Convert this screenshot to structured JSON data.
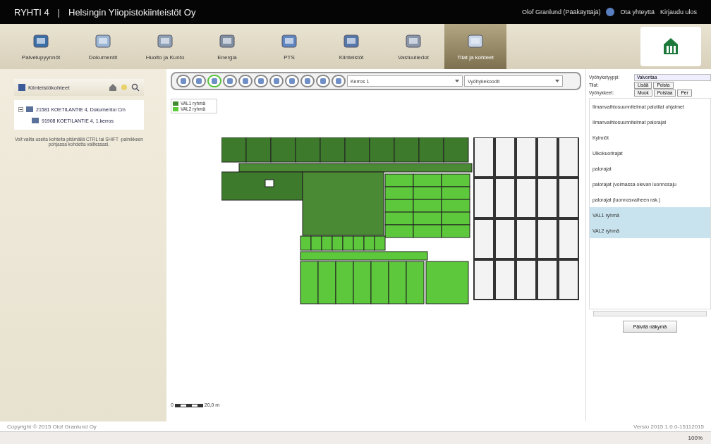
{
  "header": {
    "app": "RYHTI 4",
    "separator": "|",
    "company": "Helsingin Yliopistokiinteistöt Oy",
    "user": "Olof Granlund (Pääkäyttäjä)",
    "links": [
      "Ota yhteyttä",
      "Kirjaudu ulos"
    ]
  },
  "nav": [
    {
      "label": "Palvelupyynnöt",
      "selected": false
    },
    {
      "label": "Dokumentit",
      "selected": false
    },
    {
      "label": "Huolto ja Kunto",
      "selected": false
    },
    {
      "label": "Energia",
      "selected": false
    },
    {
      "label": "PTS",
      "selected": false
    },
    {
      "label": "Kiinteistöt",
      "selected": false
    },
    {
      "label": "Vastuutiedot",
      "selected": false
    },
    {
      "label": "Tilat ja kohteet",
      "selected": true
    }
  ],
  "sidebar": {
    "title": "Kiinteistökohteet",
    "tree": [
      {
        "label": "21581 KOETILANTIE 4, Dokumentoi Cm",
        "expanded": true,
        "children": [
          {
            "label": "91908 KOETILANTIE 4, 1.kerros"
          }
        ]
      }
    ],
    "note": "Voit valita useita kohteita pitämällä CTRL tai SHIFT -painikkeen pohjassa kohdetta valitessasi."
  },
  "toolbar": {
    "tools": [
      {
        "selected": false
      },
      {
        "selected": false
      },
      {
        "selected": true
      },
      {
        "selected": false
      },
      {
        "selected": false
      },
      {
        "selected": false
      },
      {
        "selected": false
      },
      {
        "selected": false
      },
      {
        "selected": false
      },
      {
        "selected": false
      },
      {
        "selected": false
      }
    ],
    "floor": "Kerros 1",
    "layer": "Vyöhykekoodit"
  },
  "legend": [
    {
      "label": "VAL1 ryhmä",
      "color": "#3f8a2e"
    },
    {
      "label": "VAL2 ryhmä",
      "color": "#5cc83a"
    }
  ],
  "scale": {
    "start": "0",
    "end": "20,0 m"
  },
  "panel": {
    "zone_type_label": "Vyöhyketyyppi:",
    "zone_type": "Valvontaa",
    "rooms_label": "Tilat:",
    "room_buttons": [
      "Lisää",
      "Poista"
    ],
    "zones_label": "Vyöhykkeet:",
    "zone_buttons": [
      "Muok",
      "Poistaa",
      "Per"
    ],
    "items": [
      {
        "label": "Ilmanvaihtosuunnitelmat palotilat ohjaimet",
        "selected": false
      },
      {
        "label": "Ilmanvaihtosuunnitelmat palorajat",
        "selected": false
      },
      {
        "label": "Kylmiöt",
        "selected": false
      },
      {
        "label": "Ulkokuorirajat",
        "selected": false
      },
      {
        "label": "palorajat",
        "selected": false
      },
      {
        "label": "palorajat (voimassa olevan luonnosaju",
        "selected": false
      },
      {
        "label": "palorajat (luonnosvaiheen rak.)",
        "selected": false
      },
      {
        "label": "VAL1 ryhmä",
        "selected": true
      },
      {
        "label": "VAL2 ryhmä",
        "selected": true
      }
    ],
    "update_button": "Päivitä näkymä"
  },
  "footer": {
    "copyright": "Copyright © 2015 Olof Granlund Oy",
    "version": "Versio 2015.1.0.0-15112015",
    "zoom": "100%"
  }
}
